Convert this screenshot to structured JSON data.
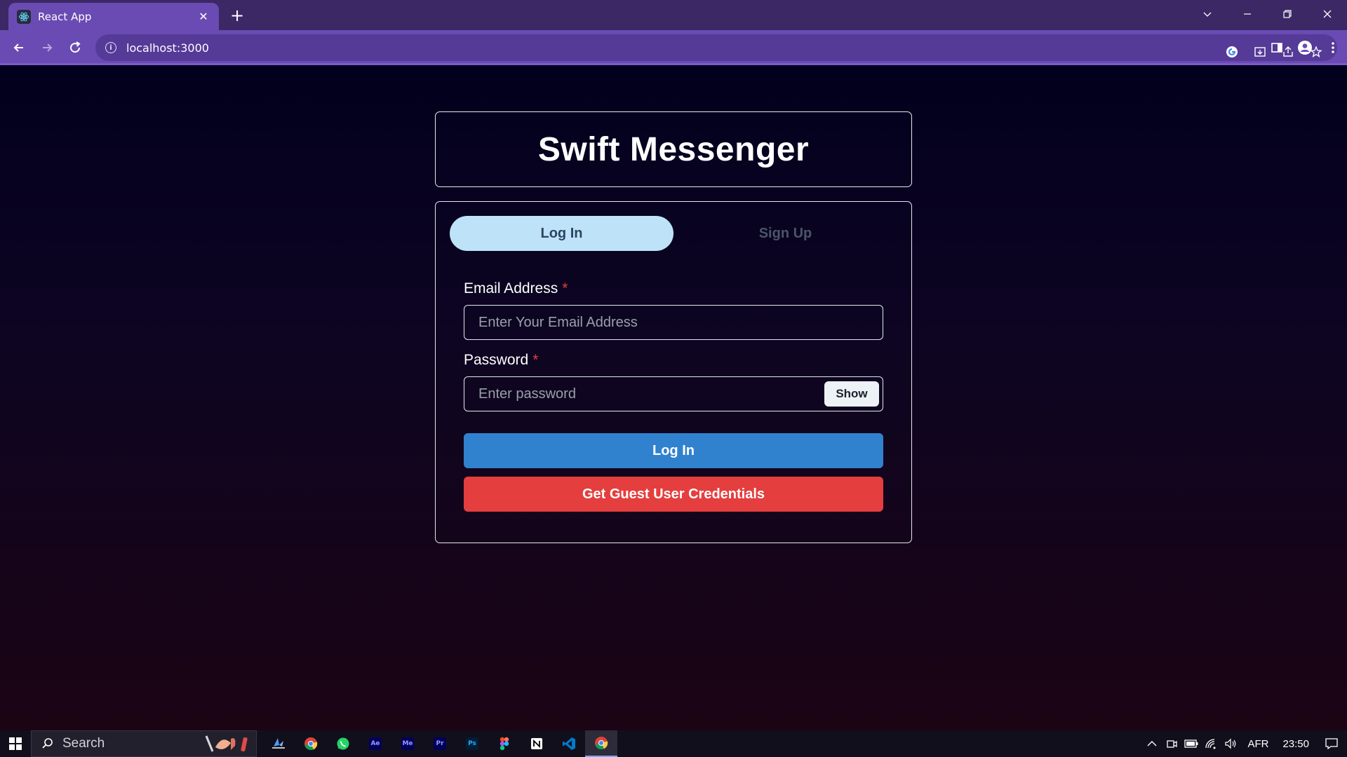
{
  "browser": {
    "tab_title": "React App",
    "tab_close": "✕",
    "new_tab": "+",
    "url": "localhost:3000"
  },
  "app": {
    "title": "Swift Messenger"
  },
  "auth_tabs": {
    "login": "Log In",
    "signup": "Sign Up"
  },
  "form": {
    "email_label": "Email Address",
    "email_placeholder": "Enter Your Email Address",
    "password_label": "Password",
    "password_placeholder": "Enter password",
    "required_mark": "*",
    "show_label": "Show",
    "login_button": "Log In",
    "guest_button": "Get Guest User Credentials"
  },
  "taskbar": {
    "search_label": "Search",
    "apps": [
      {
        "name": "Ae",
        "color": "#00005b",
        "fg": "#9999ff"
      },
      {
        "name": "Me",
        "color": "#00005b",
        "fg": "#9999ff"
      },
      {
        "name": "Pr",
        "color": "#00005b",
        "fg": "#9999ff"
      },
      {
        "name": "Ps",
        "color": "#001e36",
        "fg": "#31a8ff"
      }
    ],
    "language": "AFR",
    "time": "23:50"
  },
  "colors": {
    "tab_active": "#6a4bb3",
    "login_btn": "#3182ce",
    "guest_btn": "#e53e3e",
    "tab_pill": "#bee3f8",
    "required": "#e53e3e"
  }
}
